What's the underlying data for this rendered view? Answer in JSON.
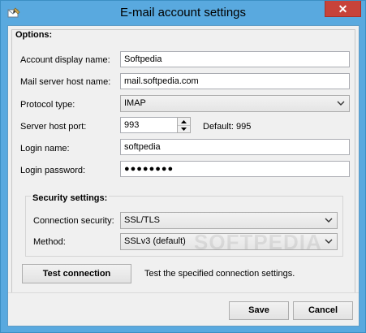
{
  "window": {
    "title": "E-mail account settings"
  },
  "titlebar": {
    "close_glyph": "✕",
    "app_icon": "mail-settings-icon"
  },
  "options": {
    "group_title": "Options:",
    "account_display_name": {
      "label": "Account display name:",
      "value": "Softpedia"
    },
    "mail_server_host_name": {
      "label": "Mail server host name:",
      "value": "mail.softpedia.com"
    },
    "protocol_type": {
      "label": "Protocol type:",
      "value": "IMAP"
    },
    "server_host_port": {
      "label": "Server host port:",
      "value": "993",
      "default_text": "Default: 995"
    },
    "login_name": {
      "label": "Login name:",
      "value": "softpedia"
    },
    "login_password": {
      "label": "Login password:",
      "value": "●●●●●●●●"
    }
  },
  "security": {
    "group_title": "Security settings:",
    "connection_security": {
      "label": "Connection security:",
      "value": "SSL/TLS"
    },
    "method": {
      "label": "Method:",
      "value": "SSLv3 (default)"
    }
  },
  "test": {
    "button_label": "Test connection",
    "description": "Test the specified connection settings."
  },
  "footer": {
    "save_label": "Save",
    "cancel_label": "Cancel"
  },
  "watermark": "SOFTPEDIA",
  "colors": {
    "titlebar": "#59a9df",
    "close": "#c7433a",
    "client_bg": "#f0f0f0"
  }
}
